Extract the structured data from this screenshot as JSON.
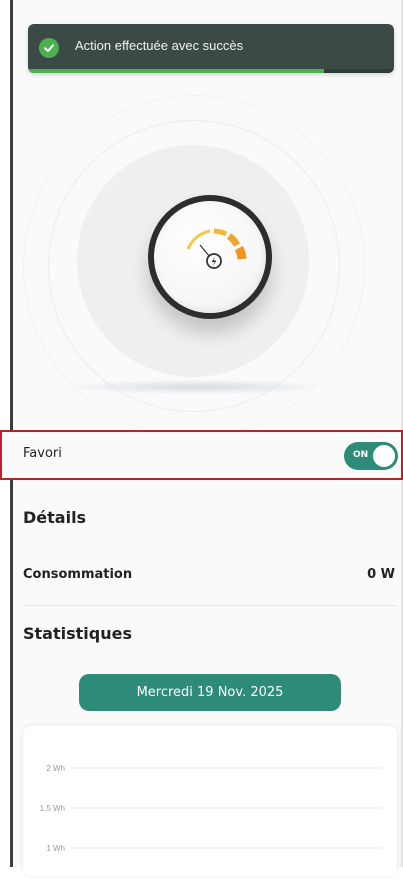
{
  "toast": {
    "message": "Action effectuée avec succès",
    "progress": 0.81,
    "accent": "#4caf50",
    "icon": "check-circle-icon"
  },
  "device": {
    "image": "smart-plug-with-power-gauge-icon"
  },
  "favorite": {
    "label": "Favori",
    "toggle_label": "ON",
    "on": true
  },
  "details": {
    "title": "Détails",
    "consumption_label": "Consommation",
    "consumption_value": "0 W"
  },
  "stats": {
    "title": "Statistiques",
    "date_button": "Mercredi 19 Nov. 2025"
  },
  "chart_data": {
    "type": "line",
    "title": "",
    "xlabel": "",
    "ylabel": "",
    "y_ticks": [
      "2 Wh",
      "1.5 Wh",
      "1 Wh"
    ],
    "y_tick_values": [
      2,
      1.5,
      1
    ],
    "series": [],
    "grid": true
  },
  "colors": {
    "primary": "#2e8b7a",
    "highlight_border": "#c0202a",
    "toast_bg": "#3b4a47"
  }
}
